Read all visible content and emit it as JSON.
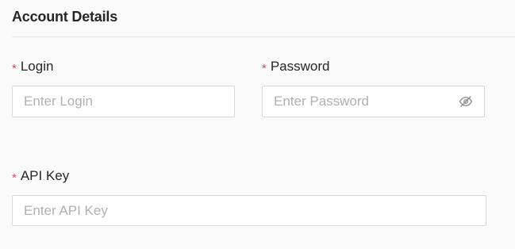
{
  "section": {
    "title": "Account Details"
  },
  "fields": {
    "login": {
      "required_mark": "*",
      "label": "Login",
      "placeholder": "Enter Login",
      "value": ""
    },
    "password": {
      "required_mark": "*",
      "label": "Password",
      "placeholder": "Enter Password",
      "value": "",
      "toggle_icon": "eye-off-icon"
    },
    "api_key": {
      "required_mark": "*",
      "label": "API Key",
      "placeholder": "Enter API Key",
      "value": ""
    }
  },
  "colors": {
    "required": "#e5484d",
    "border": "#d9d9d9",
    "placeholder": "#b0b0b0",
    "background": "#fafafa"
  }
}
